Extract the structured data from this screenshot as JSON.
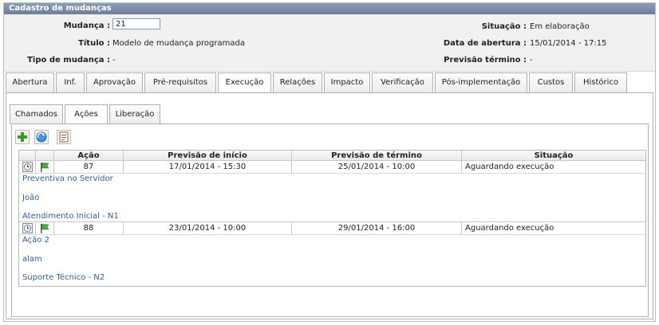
{
  "window": {
    "title": "Cadastro de mudanças"
  },
  "header": {
    "mudanca_label": "Mudança :",
    "mudanca_value": "21",
    "titulo_label": "Título :",
    "titulo_value": "Modelo de mudança programada",
    "tipo_label": "Tipo de mudança :",
    "tipo_value": "-",
    "situacao_label": "Situação :",
    "situacao_value": "Em elaboração",
    "abertura_label": "Data de abertura :",
    "abertura_value": "15/01/2014 - 17:15",
    "previsao_label": "Previsão término :",
    "previsao_value": "-"
  },
  "tabs": [
    {
      "label": "Abertura"
    },
    {
      "label": "Inf."
    },
    {
      "label": "Aprovação"
    },
    {
      "label": "Pré-requisitos"
    },
    {
      "label": "Execução"
    },
    {
      "label": "Relações"
    },
    {
      "label": "Impacto"
    },
    {
      "label": "Verificação"
    },
    {
      "label": "Pós-implementação"
    },
    {
      "label": "Custos"
    },
    {
      "label": "Histórico"
    }
  ],
  "active_tab": "Execução",
  "subtabs": [
    {
      "label": "Chamados"
    },
    {
      "label": "Ações"
    },
    {
      "label": "Liberação"
    }
  ],
  "active_subtab": "Ações",
  "toolbar": {
    "add_icon": "plus-icon",
    "refresh_icon": "refresh-icon",
    "report_icon": "report-icon"
  },
  "grid": {
    "columns": [
      "",
      "",
      "Ação",
      "Previsão de início",
      "Previsão de término",
      "Situação"
    ],
    "rows": [
      {
        "acao": "87",
        "inicio": "17/01/2014 - 15:30",
        "termino": "25/01/2014 - 10:00",
        "situacao": "Aguardando execução",
        "details": [
          "Preventiva no Servidor",
          "João",
          "Atendimento Inicial - N1"
        ]
      },
      {
        "acao": "88",
        "inicio": "23/01/2014 - 10:00",
        "termino": "29/01/2014 - 16:00",
        "situacao": "Aguardando execução",
        "details": [
          "Ação 2",
          "alam",
          "Suporte Técnico - N2"
        ]
      }
    ]
  },
  "colors": {
    "titlebar": "#6c7f99",
    "detail_text": "#2f5f9e",
    "header_bg": "#f1f1f1"
  }
}
